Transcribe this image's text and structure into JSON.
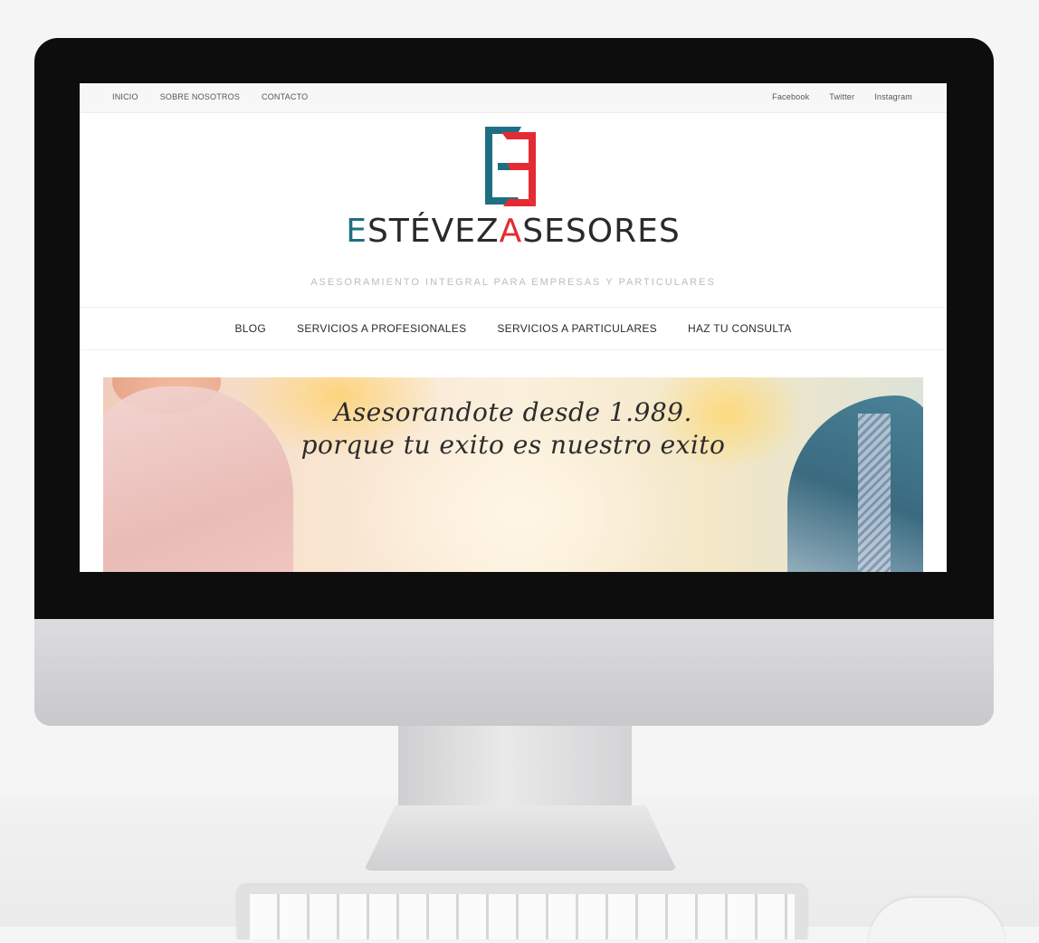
{
  "topbar": {
    "left_links": [
      "INICIO",
      "SOBRE NOSOTROS",
      "CONTACTO"
    ],
    "right_links": [
      "Facebook",
      "Twitter",
      "Instagram"
    ]
  },
  "logo": {
    "word1_initial": "E",
    "word1_rest": "STÉVEZ",
    "word2_initial": "A",
    "word2_rest": "SESORES",
    "colors": {
      "teal": "#1f6f82",
      "red": "#e42b33",
      "dark": "#2a2a2e"
    }
  },
  "tagline": "ASESORAMIENTO INTEGRAL PARA EMPRESAS Y PARTICULARES",
  "main_nav": [
    "BLOG",
    "SERVICIOS A PROFESIONALES",
    "SERVICIOS A PARTICULARES",
    "HAZ TU CONSULTA"
  ],
  "hero": {
    "line1": "Asesorandote desde 1.989.",
    "line2": "porque tu exito es nuestro exito"
  }
}
